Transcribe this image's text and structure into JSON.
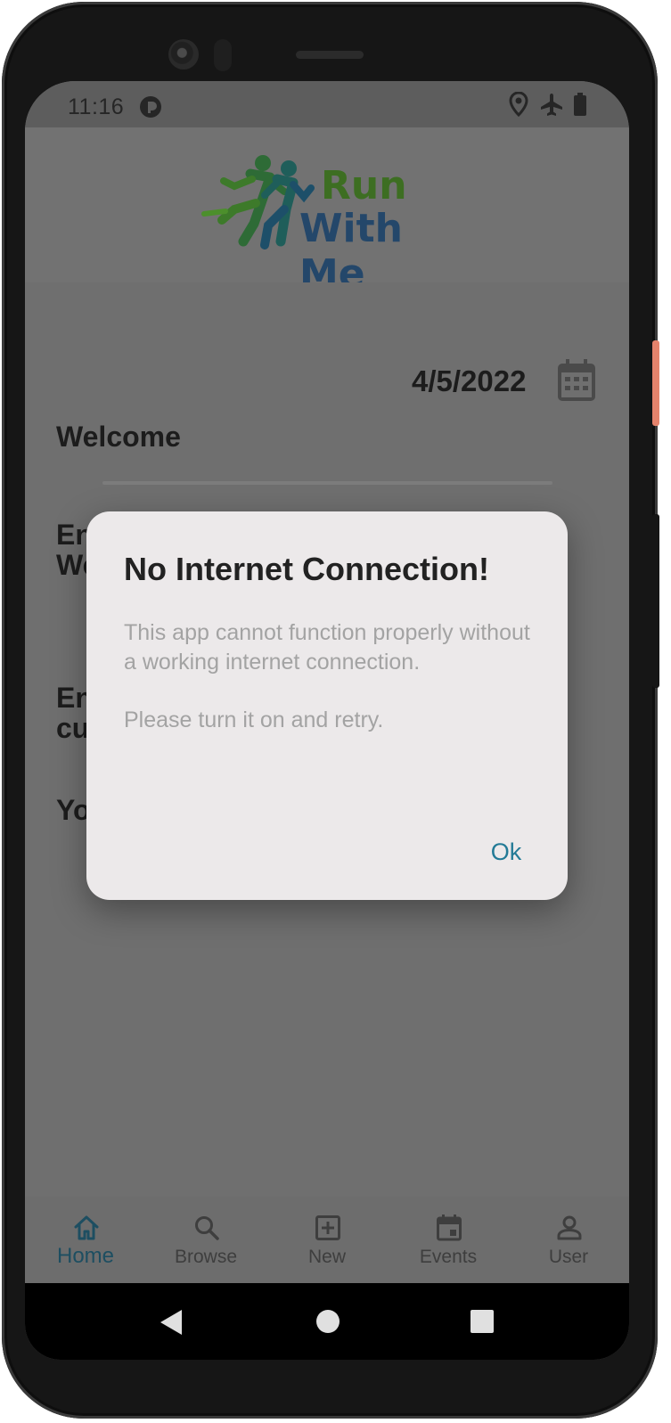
{
  "status_bar": {
    "time": "11:16",
    "icons": [
      "notification-icon",
      "location-icon",
      "airplane-mode-icon",
      "battery-icon"
    ]
  },
  "header": {
    "logo_line1": "Run",
    "logo_line2": "With Me",
    "logo_color_green": "#3d6e22",
    "logo_color_blue": "#24476a"
  },
  "main": {
    "date": "4/5/2022",
    "welcome": "Welcome",
    "section2_line1": "En",
    "section2_line2": "We",
    "section3_line1": "En",
    "section3_line2": "cu",
    "section4_line1": "Yo"
  },
  "dialog": {
    "title": "No Internet Connection!",
    "body": "This app cannot function properly without a working internet connection.",
    "instruction": "Please turn it on and retry.",
    "ok_label": "Ok",
    "accent_color": "#237a96"
  },
  "bottom_nav": {
    "items": [
      {
        "label": "Home",
        "icon": "home-icon",
        "active": true
      },
      {
        "label": "Browse",
        "icon": "search-icon",
        "active": false
      },
      {
        "label": "New",
        "icon": "add-box-icon",
        "active": false
      },
      {
        "label": "Events",
        "icon": "event-icon",
        "active": false
      },
      {
        "label": "User",
        "icon": "user-icon",
        "active": false
      }
    ]
  },
  "system_nav": [
    "back-icon",
    "home-circle-icon",
    "recents-icon"
  ]
}
